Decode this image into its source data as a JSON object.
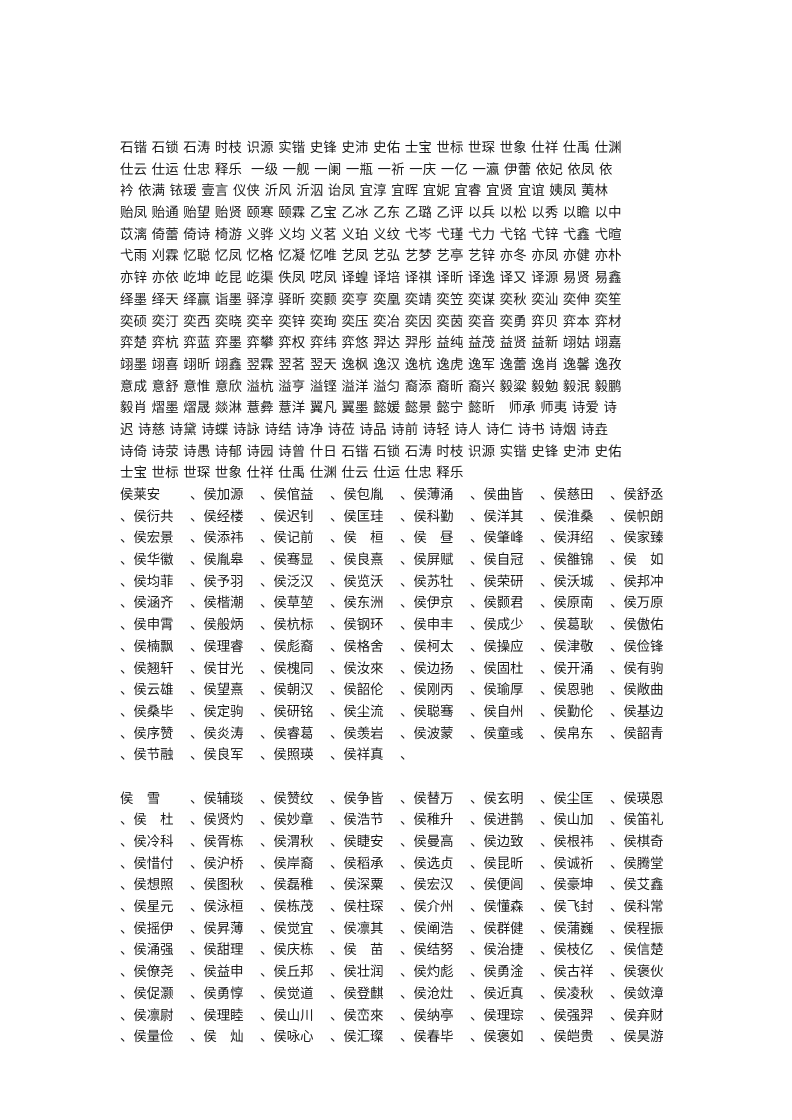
{
  "paragraph_lines": [
    "石锴 石锁 石涛 时枝 识源 实锴 史锋 史沛 史佑 士宝 世标 世琛 世象 仕祥 仕禹 仕渊",
    "仕云 仕运 仕忠 释乐  一级 一舰 一阑 一瓶 一祈 一庆 一亿 一瀛 伊蕾 依妃 依凤 依",
    "衿 依满 铱瑗 壹言 仪侠 沂风 沂泅 诒凤 宜淳 宜晖 宜妮 宜睿 宜贤 宜谊 姨凤 荑林",
    "贻凤 贻通 贻望 贻贤 颐寒 颐霖 乙宝 乙冰 乙东 乙璐 乙评 以兵 以松 以秀 以瞻 以中",
    "苡漓 倚蕾 倚诗 椅游 义骅 义均 义茗 义珀 义纹 弋岑 弋瑾 弋力 弋铭 弋锌 弋鑫 弋暄",
    "弋雨 刈霖 忆聪 忆凤 忆格 忆凝 忆唯 艺凤 艺弘 艺梦 艺亭 艺锌 亦冬 亦凤 亦健 亦朴",
    "亦锌 亦依 屹坤 屹昆 屹渠 佚凤 呓凤 译蝗 译培 译祺 译昕 译逸 译又 译源 易贤 易鑫",
    "绎墨 绎天 绎赢 诣墨 驿淳 驿昕 奕颢 奕亨 奕凰 奕靖 奕笠 奕谋 奕秋 奕汕 奕伸 奕笙",
    "奕硕 奕汀 奕西 奕晓 奕辛 奕锌 奕珣 奕压 奕冶 奕因 奕茵 奕音 奕勇 弈贝 弈本 弈材",
    "弈楚 弈杭 弈蓝 弈墨 弈攀 弈权 弈纬 弈悠 羿达 羿彤 益纯 益茂 益贤 益新 翊姑 翊嘉",
    "翊墨 翊喜 翊昕 翊鑫 翌霖 翌茗 翌天 逸枫 逸汉 逸杭 逸虎 逸军 逸蕾 逸肖 逸馨 逸孜",
    "意成 意舒 意惟 意欣 溢杭 溢亨 溢铿 溢洋 溢匀 裔添 裔昕 裔兴 毅粱 毅勉 毅泯 毅鹏",
    "毅肖 熠墨 熠晟 燚淋 薏彜 薏洋 翼凡 翼墨 懿媛 懿景 懿宁 懿昕   师承 师夷 诗爱 诗",
    "迟 诗慈 诗黛 诗蝶 诗詠 诗结 诗净 诗莅 诗品 诗前 诗轻 诗人 诗仁 诗书 诗烟 诗垚",
    "诗倚 诗荥 诗愚 诗郁 诗园 诗曾 什日 石锴 石锁 石涛 时枝 识源 实锴 史锋 史沛 史佑",
    "士宝 世标 世琛 世象 仕祥 仕禹 仕渊 仕云 仕运 仕忠 释乐"
  ],
  "list1": {
    "rows": [
      [
        "侯莱安",
        "、侯加源",
        "、侯倌益",
        "、侯包胤",
        "、侯薄涌",
        "、侯曲皆",
        "、侯慈田",
        "、侯舒丞"
      ],
      [
        "、侯衍共",
        "、侯经楼",
        "、侯迟钊",
        "、侯匡珪",
        "、侯科勤",
        "、侯洋其",
        "、侯淮桑",
        "、侯帜朗"
      ],
      [
        "、侯宏景",
        "、侯添祎",
        "、侯记前",
        "、侯　桓",
        "、侯　昼",
        "、侯肇峰",
        "、侯湃绍",
        "、侯家臻"
      ],
      [
        "、侯华徽",
        "、侯胤皋",
        "、侯骞显",
        "、侯良熹",
        "、侯屏赋",
        "、侯自冠",
        "、侯雒锦",
        "、侯　如"
      ],
      [
        "、侯均菲",
        "、侯予羽",
        "、侯泛汉",
        "、侯览沃",
        "、侯苏牡",
        "、侯荣研",
        "、侯沃城",
        "、侯邦冲"
      ],
      [
        "、侯涵齐",
        "、侯楷潮",
        "、侯草堃",
        "、侯东洲",
        "、侯伊京",
        "、侯颢君",
        "、侯原南",
        "、侯万原"
      ],
      [
        "、侯申霄",
        "、侯般炳",
        "、侯杭标",
        "、侯钢环",
        "、侯申丰",
        "、侯成少",
        "、侯葛耿",
        "、侯傲佑"
      ],
      [
        "、侯楠飘",
        "、侯理睿",
        "、侯彪裔",
        "、侯格舍",
        "、侯柯太",
        "、侯操应",
        "、侯津敬",
        "、侯俭锋"
      ],
      [
        "、侯翘轩",
        "、侯甘光",
        "、侯槐同",
        "、侯汝來",
        "、侯边扬",
        "、侯固杜",
        "、侯开涌",
        "、侯有驹"
      ],
      [
        "、侯云雄",
        "、侯望熹",
        "、侯朝汉",
        "、侯韶伦",
        "、侯刚丙",
        "、侯瑜厚",
        "、侯恩驰",
        "、侯敞曲"
      ],
      [
        "、侯桑毕",
        "、侯定驹",
        "、侯研铭",
        "、侯尘流",
        "、侯聪骞",
        "、侯自州",
        "、侯勤伦",
        "、侯基边"
      ],
      [
        "、侯序赞",
        "、侯炎涛",
        "、侯睿葛",
        "、侯羡岩",
        "、侯波蒙",
        "、侯童彧",
        "、侯帛东",
        "、侯韶青"
      ],
      [
        "、侯节融",
        "、侯良军",
        "、侯照瑛",
        "、侯祥真",
        "、",
        "",
        "",
        ""
      ]
    ]
  },
  "list2": {
    "rows": [
      [
        "侯　雪",
        "、侯辅琰",
        "、侯赞纹",
        "、侯争皆",
        "、侯替万",
        "、侯玄明",
        "、侯尘匡",
        "、侯瑛恩"
      ],
      [
        "、侯　杜",
        "、侯贤灼",
        "、侯妙章",
        "、侯浩节",
        "、侯稚升",
        "、侯进鹊",
        "、侯山加",
        "、侯笛礼"
      ],
      [
        "、侯冷科",
        "、侯胥栋",
        "、侯渭秋",
        "、侯睫安",
        "、侯曼高",
        "、侯边致",
        "、侯根祎",
        "、侯棋奇"
      ],
      [
        "、侯惜付",
        "、侯沪桥",
        "、侯岸裔",
        "、侯稻承",
        "、侯选贞",
        "、侯昆昕",
        "、侯诚祈",
        "、侯腾堂"
      ],
      [
        "、侯想照",
        "、侯图秋",
        "、侯磊稚",
        "、侯深粟",
        "、侯宏汉",
        "、侯便闾",
        "、侯豪坤",
        "、侯艾鑫"
      ],
      [
        "、侯星元",
        "、侯泳桓",
        "、侯栋茂",
        "、侯柱琛",
        "、侯介州",
        "、侯懂森",
        "、侯飞封",
        "、侯科常"
      ],
      [
        "、侯摇伊",
        "、侯昇薄",
        "、侯觉宜",
        "、侯凛其",
        "、侯阐浩",
        "、侯群健",
        "、侯蒲巍",
        "、侯程振"
      ],
      [
        "、侯涌强",
        "、侯甜理",
        "、侯庆栋",
        "、侯　苗",
        "、侯结努",
        "、侯治捷",
        "、侯枝亿",
        "、侯信楚"
      ],
      [
        "、侯僚尧",
        "、侯益申",
        "、侯丘邦",
        "、侯壮润",
        "、侯灼彪",
        "、侯勇淦",
        "、侯古祥",
        "、侯褒伙"
      ],
      [
        "、侯促灏",
        "、侯勇惇",
        "、侯觉道",
        "、侯登麒",
        "、侯沧灶",
        "、侯近真",
        "、侯凌秋",
        "、侯敛漳"
      ],
      [
        "、侯凛尉",
        "、侯理睦",
        "、侯山川",
        "、侯峦來",
        "、侯纳亭",
        "、侯理琮",
        "、侯强羿",
        "、侯弃财"
      ],
      [
        "、侯量俭",
        "、侯　灿",
        "、侯咏心",
        "、侯汇璨",
        "、侯春毕",
        "、侯褒如",
        "、侯皑贵",
        "、侯昊游"
      ]
    ]
  }
}
